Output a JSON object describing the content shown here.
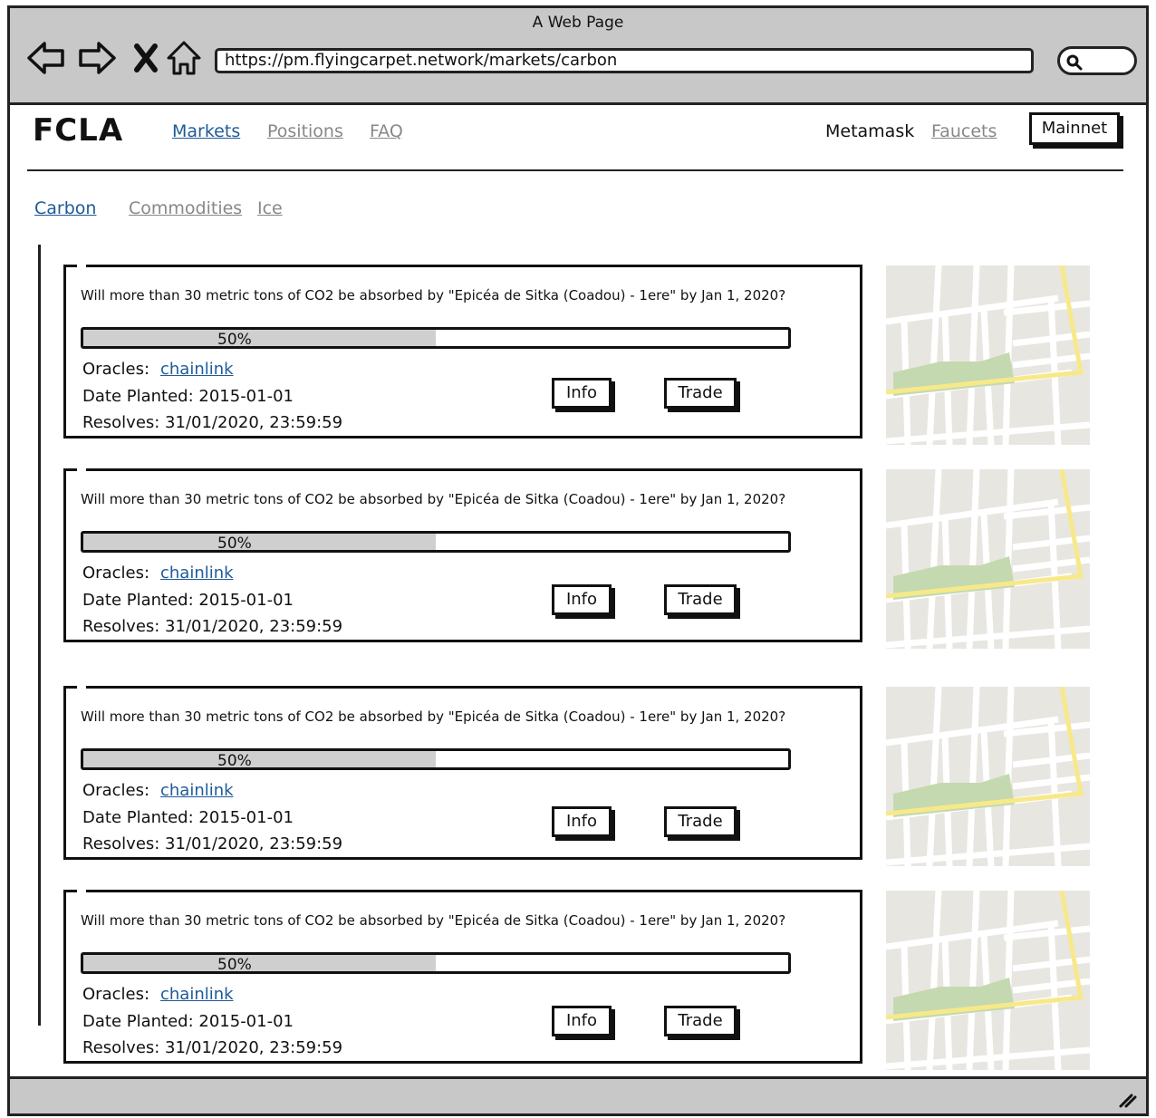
{
  "browser": {
    "window_title": "A Web Page",
    "url": "https://pm.flyingcarpet.network/markets/carbon"
  },
  "header": {
    "logo": "FCLA",
    "nav": [
      {
        "label": "Markets",
        "active": true
      },
      {
        "label": "Positions",
        "active": false
      },
      {
        "label": "FAQ",
        "active": false
      }
    ],
    "metamask": "Metamask",
    "faucets": "Faucets",
    "network_button": "Mainnet"
  },
  "subnav": [
    {
      "label": "Carbon",
      "active": true
    },
    {
      "label": "Commodities",
      "active": false
    },
    {
      "label": "Ice",
      "active": false
    }
  ],
  "markets": [
    {
      "question": "Will more than 30 metric tons of CO2 be absorbed by \"Epicéa de Sitka (Coadou) - 1ere\" by Jan 1, 2020?",
      "progress": 0.5,
      "progress_label": "50%",
      "oracles_label": "Oracles:",
      "oracle": "chainlink",
      "date_planted": "Date Planted: 2015-01-01",
      "resolves": "Resolves: 31/01/2020, 23:59:59",
      "info_label": "Info",
      "trade_label": "Trade"
    },
    {
      "question": "Will more than 30 metric tons of CO2 be absorbed by \"Epicéa de Sitka (Coadou) - 1ere\" by Jan 1, 2020?",
      "progress": 0.5,
      "progress_label": "50%",
      "oracles_label": "Oracles:",
      "oracle": "chainlink",
      "date_planted": "Date Planted: 2015-01-01",
      "resolves": "Resolves: 31/01/2020, 23:59:59",
      "info_label": "Info",
      "trade_label": "Trade"
    },
    {
      "question": "Will more than 30 metric tons of CO2 be absorbed by \"Epicéa de Sitka (Coadou) - 1ere\" by Jan 1, 2020?",
      "progress": 0.5,
      "progress_label": "50%",
      "oracles_label": "Oracles:",
      "oracle": "chainlink",
      "date_planted": "Date Planted: 2015-01-01",
      "resolves": "Resolves: 31/01/2020, 23:59:59",
      "info_label": "Info",
      "trade_label": "Trade"
    },
    {
      "question": "Will more than 30 metric tons of CO2 be absorbed by \"Epicéa de Sitka (Coadou) - 1ere\" by Jan 1, 2020?",
      "progress": 0.5,
      "progress_label": "50%",
      "oracles_label": "Oracles:",
      "oracle": "chainlink",
      "date_planted": "Date Planted: 2015-01-01",
      "resolves": "Resolves: 31/01/2020, 23:59:59",
      "info_label": "Info",
      "trade_label": "Trade"
    }
  ],
  "colors": {
    "link_active": "#1f5a99",
    "link_inactive": "#888888",
    "chrome": "#c8c8c8",
    "progress_fill": "#cfcfcf",
    "map_background": "#e8e6e1",
    "map_road": "#ffffff",
    "map_highway": "#f7e98a",
    "map_park": "#c5d9b0"
  },
  "icons": [
    "back-arrow-icon",
    "forward-arrow-icon",
    "stop-icon",
    "home-icon",
    "search-icon",
    "resize-grip-icon",
    "map-thumbnail"
  ]
}
